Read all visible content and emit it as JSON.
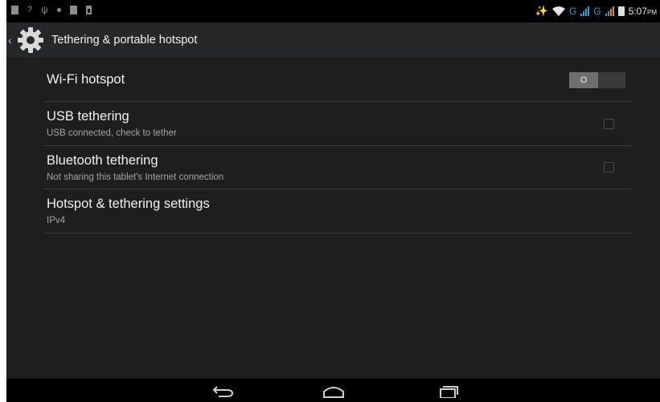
{
  "status_bar": {
    "icons_left": [
      "notification-icon",
      "wifi-question-icon",
      "usb-icon",
      "dot-icon",
      "notification-icon",
      "sd-card-icon"
    ],
    "network_label_1": "G",
    "network_label_2": "G",
    "time": "5:07",
    "time_suffix": "PM",
    "colors": {
      "signal": "#2f9fd8"
    }
  },
  "action_bar": {
    "icon": "settings-gear-icon",
    "title": "Tethering & portable hotspot"
  },
  "preferences": [
    {
      "title": "Wi-Fi hotspot",
      "summary": "",
      "widget": "toggle",
      "toggle_state": "O"
    },
    {
      "title": "USB tethering",
      "summary": "USB connected, check to tether",
      "widget": "checkbox",
      "checked": false
    },
    {
      "title": "Bluetooth tethering",
      "summary": "Not sharing this tablet's Internet connection",
      "widget": "checkbox",
      "checked": false
    },
    {
      "title": "Hotspot & tethering settings",
      "summary": "IPv4",
      "widget": "none"
    }
  ],
  "nav_bar": {
    "buttons": [
      "back-icon",
      "home-icon",
      "recents-icon"
    ]
  }
}
